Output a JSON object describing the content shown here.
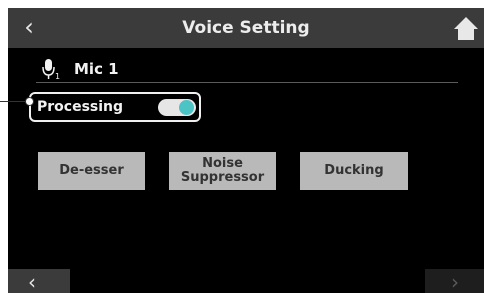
{
  "header": {
    "title": "Voice Setting",
    "back_icon": "chevron-left",
    "home_icon": "home"
  },
  "mic": {
    "icon": "microphone",
    "channel_label": "Mic 1"
  },
  "processing": {
    "label": "Processing",
    "enabled": true,
    "toggle_color": "#4cc3c4"
  },
  "buttons": [
    {
      "label": "De-esser"
    },
    {
      "label": "Noise Suppressor"
    },
    {
      "label": "Ducking"
    }
  ],
  "footer": {
    "prev_icon": "chevron-left",
    "next_icon": "chevron-right"
  }
}
